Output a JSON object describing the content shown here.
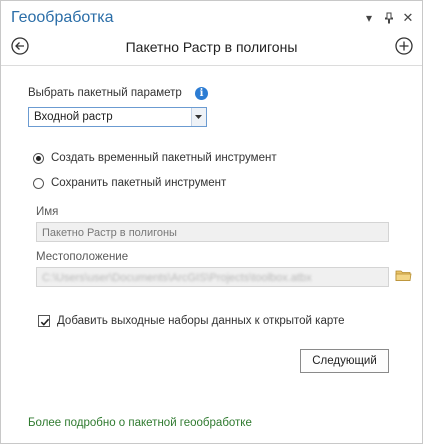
{
  "pane": {
    "title": "Геообработка",
    "menu_glyph": "▾",
    "pin_glyph": "⊥",
    "close_glyph": "✕"
  },
  "tool": {
    "title": "Пакетно Растр в полигоны"
  },
  "batch_parameter": {
    "label": "Выбрать пакетный параметр",
    "info_glyph": "i",
    "selected": "Входной растр"
  },
  "mode": {
    "option_temp": "Создать временный пакетный инструмент",
    "option_save": "Сохранить пакетный инструмент",
    "selected": "option_temp"
  },
  "name_field": {
    "label": "Имя",
    "value": "Пакетно Растр в полигоны"
  },
  "location_field": {
    "label": "Местоположение",
    "value": "C:\\Users\\user\\Documents\\ArcGIS\\Projects\\toolbox.atbx"
  },
  "add_outputs": {
    "label": "Добавить выходные наборы данных к открытой карте",
    "checked": true
  },
  "next_button": {
    "label": "Следующий"
  },
  "learn_more": {
    "label": "Более подробно о пакетной геообработке"
  },
  "colors": {
    "accent": "#2b6ea8",
    "link": "#2f7a2f",
    "info": "#2c7cd3"
  }
}
